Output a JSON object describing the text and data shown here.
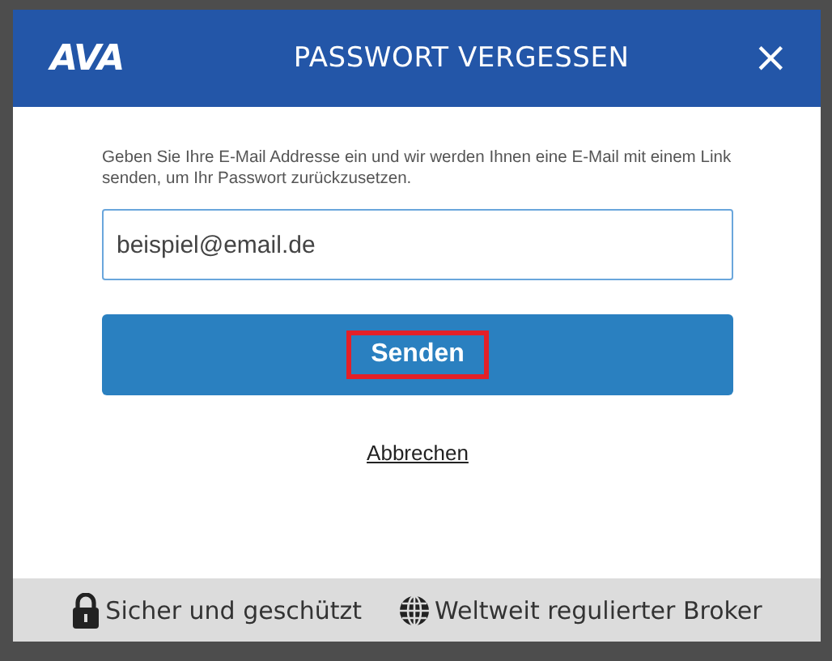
{
  "dialog": {
    "logo": "AVA",
    "title": "PASSWORT VERGESSEN",
    "close": "×",
    "instructions": "Geben Sie Ihre E-Mail Addresse ein und wir werden Ihnen eine E-Mail mit einem Link senden, um Ihr Passwort zurückzusetzen.",
    "email_field": {
      "value": "beispiel@email.de"
    },
    "submit_button": {
      "label": "Senden",
      "highlighted": true
    },
    "cancel_link": "Abbrechen",
    "footer": [
      {
        "kind": "lock",
        "text": "Sicher und geschützt"
      },
      {
        "kind": "globe",
        "text": "Weltweit regulierter Broker"
      }
    ]
  }
}
